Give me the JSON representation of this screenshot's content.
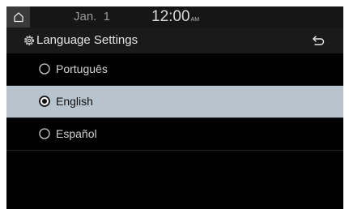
{
  "status_bar": {
    "date": "Jan.  1",
    "time": "12:00",
    "ampm": "AM"
  },
  "header": {
    "title": "Language Settings"
  },
  "languages": [
    {
      "label": "Português",
      "selected": false
    },
    {
      "label": "English",
      "selected": true
    },
    {
      "label": "Español",
      "selected": false
    }
  ],
  "colors": {
    "selected_row": "#b7c3cd",
    "background": "#000000"
  },
  "icons": [
    "home-icon",
    "gear-icon",
    "back-icon",
    "radio-unselected-icon",
    "radio-selected-icon"
  ]
}
